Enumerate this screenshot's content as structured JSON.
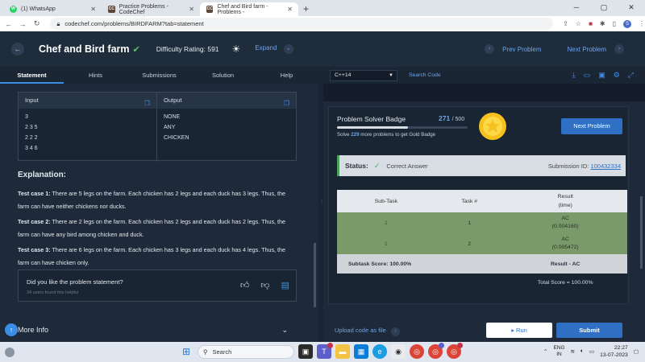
{
  "browser": {
    "tabs": [
      {
        "label": "(1) WhatsApp",
        "favicon": "W",
        "color": "#25d366"
      },
      {
        "label": "Practice Problems - CodeChef",
        "favicon": "CC",
        "color": "#5b4638"
      },
      {
        "label": "Chef and Bird farm - Problems -",
        "favicon": "CC",
        "color": "#5b4638",
        "active": true
      }
    ],
    "url": "codechef.com/problems/BIRDFARM?tab=statement",
    "profile": "S"
  },
  "header": {
    "title": "Chef and Bird farm",
    "difficulty": "Difficulty Rating: 591",
    "expand": "Expand",
    "prev": "Prev Problem",
    "next": "Next Problem"
  },
  "left_tabs": [
    "Statement",
    "Hints",
    "Submissions",
    "Solution",
    "Help"
  ],
  "io": {
    "input_label": "Input",
    "output_label": "Output",
    "input_lines": [
      "3",
      "2 3 5",
      "2 2 2",
      "3 4 6"
    ],
    "output_lines": [
      "NONE",
      "ANY",
      "CHICKEN"
    ]
  },
  "explanation": {
    "heading": "Explanation:",
    "cases": [
      {
        "label": "Test case 1:",
        "text": " There are 5 legs on the farm. Each chicken has 2 legs and each duck has 3 legs. Thus, the farm can have neither chickens nor ducks."
      },
      {
        "label": "Test case 2:",
        "text": " There are 2 legs on the farm. Each chicken has 2 legs and each duck has 2 legs. Thus, the farm can have any bird among chicken and duck."
      },
      {
        "label": "Test case 3:",
        "text": " There are 6 legs on the farm. Each chicken has 3 legs and each duck has 4 legs. Thus, the farm can have chicken only."
      }
    ]
  },
  "feedback": {
    "question": "Did you like the problem statement?",
    "count": "34 users found this helpful"
  },
  "more_info": "More Info",
  "editor": {
    "language": "C++14",
    "search": "Search Code"
  },
  "badge": {
    "title": "Problem Solver Badge",
    "solved": "271",
    "total": "/ 500",
    "progress_fraction": 0.542,
    "sub_prefix": "Solve ",
    "sub_count": "229",
    "sub_suffix": " more problems to get Gold Badge",
    "next_btn": "Next Problem"
  },
  "status": {
    "label": "Status:",
    "result": "Correct Answer",
    "submission_label": "Submission ID: ",
    "submission_id": "100432334"
  },
  "results": {
    "headers": [
      "Sub-Task",
      "Task #",
      "Result\n(time)"
    ],
    "rows": [
      {
        "subtask": "1",
        "task": "1",
        "result": "AC",
        "time": "(0.004160)"
      },
      {
        "subtask": "1",
        "task": "2",
        "result": "AC",
        "time": "(0.005472)"
      }
    ],
    "subtask_score": "Subtask Score: 100.00%",
    "result_summary": "Result - AC",
    "total_score": "Total Score = 100.00%"
  },
  "actions": {
    "upload": "Upload code as file",
    "run": "Run",
    "submit": "Submit"
  },
  "taskbar": {
    "search": "Search",
    "lang1": "ENG",
    "lang2": "IN",
    "time": "22:27",
    "date": "13-07-2023"
  },
  "colors": {
    "accent": "#2f6fc4",
    "success": "#4aa35b",
    "pass_row": "#7b9a6a"
  }
}
